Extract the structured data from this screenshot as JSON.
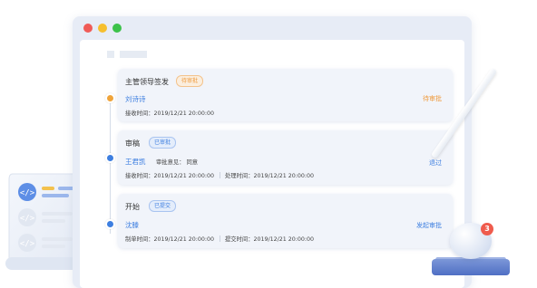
{
  "window": {
    "controls": [
      "close",
      "minimize",
      "maximize"
    ]
  },
  "timeline": [
    {
      "title": "主管领导签发",
      "status": "待审批",
      "person": "刘诗诗",
      "meta": [
        {
          "label": "接收时间：",
          "value": "2019/12/21 20:00:00"
        }
      ],
      "action": "待审批",
      "action_color": "#ef9a3c",
      "node_color": "#f0a43a"
    },
    {
      "title": "审稿",
      "status": "已审批",
      "person": "王君凯",
      "opinion_label": "审批意见：",
      "opinion_value": "同意",
      "meta": [
        {
          "label": "接收时间：",
          "value": "2019/12/21 20:00:00"
        },
        {
          "label": "处理时间：",
          "value": "2019/12/21 20:00:00"
        }
      ],
      "action": "退过",
      "action_color": "#3e7fe0",
      "node_color": "#3e7fe0"
    },
    {
      "title": "开始",
      "status": "已提交",
      "person": "沈滕",
      "meta": [
        {
          "label": "制单时间：",
          "value": "2019/12/21 20:00:00"
        },
        {
          "label": "提交时间：",
          "value": "2019/12/21 20:00:00"
        }
      ],
      "action": "发起审批",
      "action_color": "#3e7fe0",
      "node_color": "#3e7fe0"
    }
  ],
  "notification": {
    "count": "3"
  },
  "colors": {
    "accent_blue": "#3e7fe0",
    "accent_orange": "#ef9a3c",
    "alert_red": "#ef5b4d"
  }
}
